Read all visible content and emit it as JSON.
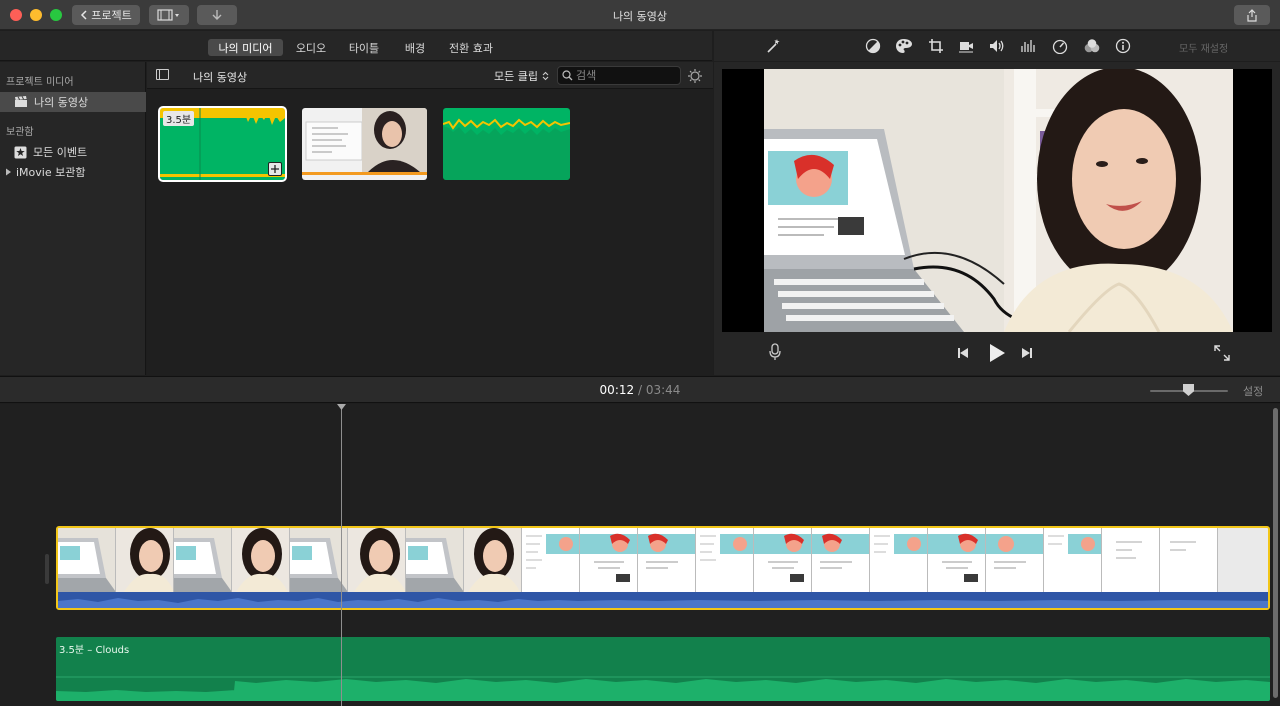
{
  "window": {
    "title": "나의 동영상",
    "projects_button": "프로젝트"
  },
  "browser_tabs": [
    {
      "label": "나의 미디어",
      "active": true
    },
    {
      "label": "오디오",
      "active": false
    },
    {
      "label": "타이틀",
      "active": false
    },
    {
      "label": "배경",
      "active": false
    },
    {
      "label": "전환 효과",
      "active": false
    }
  ],
  "viewer_toolbar": {
    "reset_all": "모두 재설정",
    "icons": [
      "magic-wand-icon",
      "color-balance-icon",
      "color-palette-icon",
      "crop-icon",
      "stabilization-icon",
      "volume-icon",
      "equalizer-icon",
      "speed-icon",
      "filter-icon",
      "info-icon"
    ]
  },
  "sidebar": {
    "header_project_media": "프로젝트 미디어",
    "project_item": "나의 동영상",
    "header_library": "보관함",
    "all_events": "모든 이벤트",
    "imovie_library": "iMovie 보관함"
  },
  "browser": {
    "title": "나의 동영상",
    "filter": "모든 클립",
    "search_placeholder": "검색",
    "clips": [
      {
        "badge": "3.5분",
        "selected": true
      },
      {
        "badge": "",
        "selected": false
      },
      {
        "badge": "",
        "selected": false
      }
    ]
  },
  "timeline": {
    "current_time": "00:12",
    "separator": "/",
    "total_time": "03:44",
    "settings": "설정",
    "music_clip_label": "3.5분 – Clouds"
  },
  "colors": {
    "accent_yellow": "#f2c618",
    "audio_green": "#12814c",
    "audio_blue": "#2f56a6",
    "browser_green": "#00b464"
  }
}
